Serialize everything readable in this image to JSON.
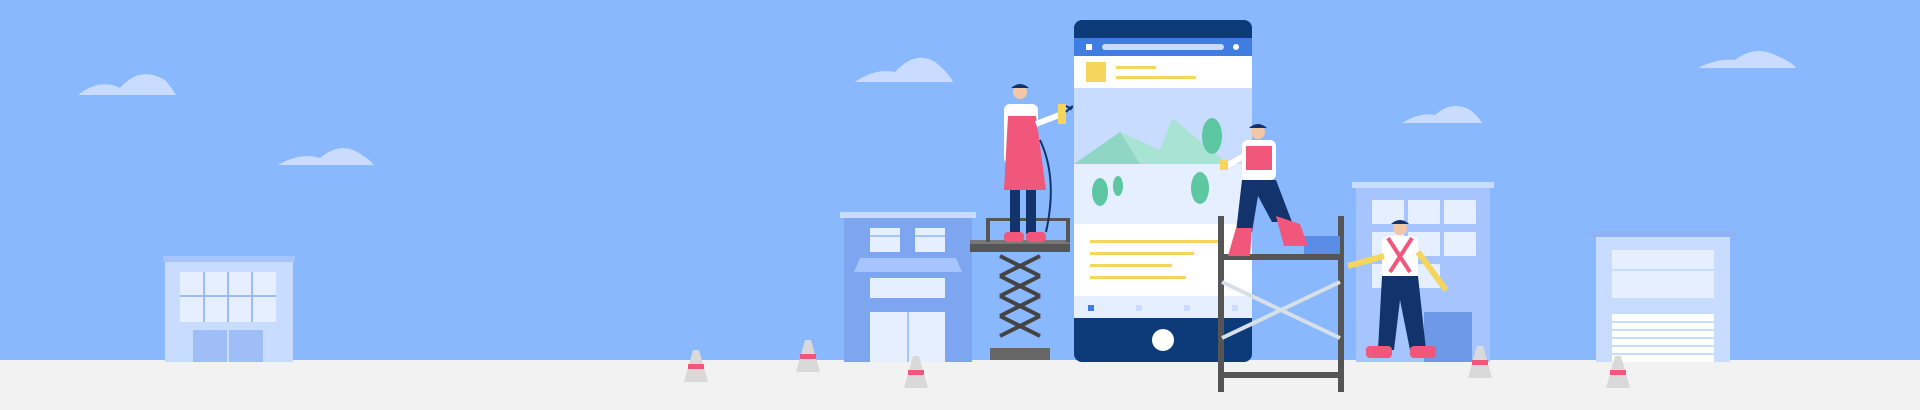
{
  "scene": {
    "description_icon": "under-construction-banner",
    "colors": {
      "sky": "#8ab8ff",
      "ground": "#f2f2f2",
      "building_light": "#c8dcff",
      "building_mid": "#7ea6f0",
      "phone_frame": "#0d3b7a",
      "phone_accent": "#f6d55c",
      "worker_red": "#f0577b",
      "worker_navy": "#12336b",
      "cone": "#d9d9d9",
      "cone_stripe": "#f0577b"
    },
    "elements": {
      "phone": "phone-mockup-illustration",
      "worker_1": "worker-on-lift",
      "worker_2": "worker-on-scaffold",
      "worker_3": "worker-standing",
      "scissor_lift": "scissor-lift",
      "scaffold": "scaffold",
      "cones": "traffic-cones",
      "buildings": "buildings",
      "clouds": "clouds"
    }
  }
}
